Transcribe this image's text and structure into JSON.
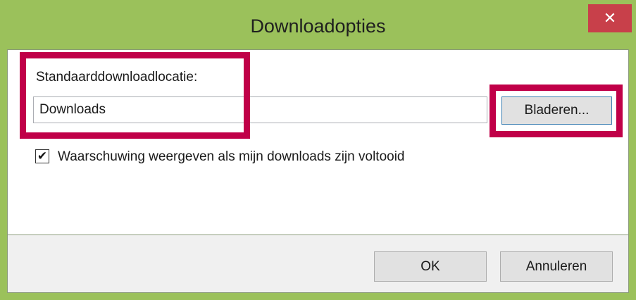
{
  "dialog": {
    "title": "Downloadopties",
    "close_label": "✕"
  },
  "location": {
    "label": "Standaarddownloadlocatie:",
    "value": "Downloads",
    "browse_label": "Bladeren..."
  },
  "notify": {
    "checked": true,
    "check_glyph": "✔",
    "label": "Waarschuwing weergeven als mijn downloads zijn voltooid"
  },
  "footer": {
    "ok_label": "OK",
    "cancel_label": "Annuleren"
  },
  "colors": {
    "frame": "#9bc15b",
    "close": "#c8404a",
    "highlight": "#c00048"
  }
}
